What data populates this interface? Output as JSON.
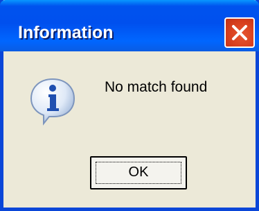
{
  "window": {
    "title": "Information",
    "close_icon": "close-icon"
  },
  "body": {
    "icon": "info-icon",
    "message": "No match found"
  },
  "buttons": {
    "ok_label": "OK"
  },
  "colors": {
    "title_bar": "#0053ee",
    "close_button": "#d8401f",
    "dialog_background": "#ece9d8",
    "window_border": "#0a46d8"
  }
}
